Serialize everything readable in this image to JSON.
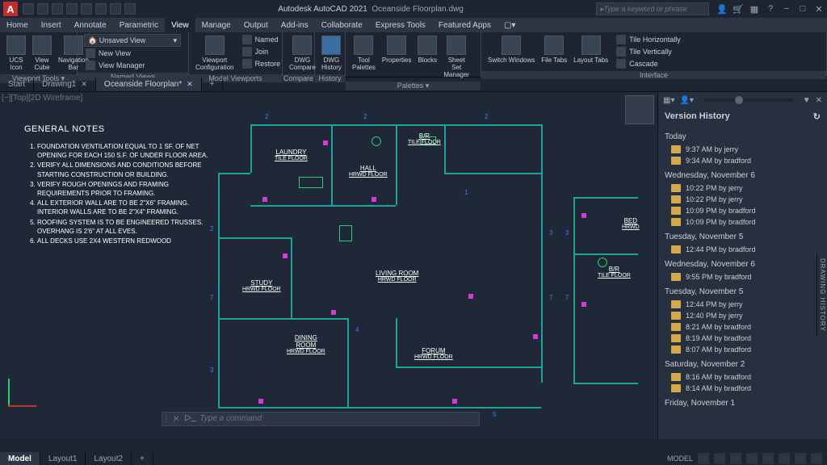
{
  "app": {
    "name": "Autodesk AutoCAD 2021",
    "document": "Oceanside Floorplan.dwg",
    "search_ph": "Type a keyword or phrase"
  },
  "menus": {
    "home": "Home",
    "insert": "Insert",
    "annotate": "Annotate",
    "parametric": "Parametric",
    "view": "View",
    "manage": "Manage",
    "output": "Output",
    "addins": "Add-ins",
    "collaborate": "Collaborate",
    "express": "Express Tools",
    "featured": "Featured Apps",
    "extra": "▢▾"
  },
  "ribbon": {
    "viewporttools": {
      "label": "Viewport Tools ▾",
      "ucs": "UCS\nIcon",
      "vcube": "View\nCube",
      "nav": "Navigation\nBar"
    },
    "namedviews": {
      "label": "Named Views",
      "combo": "Unsaved View",
      "newview": "New View",
      "viewmgr": "View Manager"
    },
    "modelvp": {
      "label": "Model Viewports",
      "vpconfig": "Viewport\nConfiguration",
      "named": "Named",
      "join": "Join",
      "restore": "Restore"
    },
    "compare": {
      "label": "Compare",
      "dwgcmp": "DWG\nCompare"
    },
    "history": {
      "label": "History",
      "dwghist": "DWG\nHistory"
    },
    "palettes": {
      "label": "Palettes ▾",
      "tool": "Tool\nPalettes",
      "prop": "Properties",
      "blocks": "Blocks",
      "sheet": "Sheet Set\nManager"
    },
    "interface": {
      "label": "Interface",
      "switch": "Switch\nWindows",
      "file": "File\nTabs",
      "layout": "Layout\nTabs",
      "tileh": "Tile Horizontally",
      "tilev": "Tile Vertically",
      "cascade": "Cascade"
    }
  },
  "tabs": {
    "start": "Start",
    "d1": "Drawing1",
    "d2": "Oceanside Floorplan*"
  },
  "viewport_label": "[−][Top][2D Wireframe]",
  "notes": {
    "title": "GENERAL NOTES",
    "items": [
      "FOUNDATION VENTILATION EQUAL TO 1 SF. OF NET OPENING FOR EACH 150 S.F. OF UNDER FLOOR AREA.",
      "VERIFY ALL DIMENSIONS AND CONDITIONS BEFORE STARTING CONSTRUCTION OR BUILDING.",
      "VERIFY ROUGH OPENINGS AND FRAMING REQUIREMENTS PRIOR TO FRAMING.",
      "ALL EXTERIOR WALL ARE TO BE 2\"X6\" FRAMING. INTERIOR WALLS ARE TO BE 2\"X4\" FRAMING.",
      "ROOFING SYSTEM IS TO BE ENGINEERED TRUSSES. OVERHANG IS 2'6\" AT ALL EVES.",
      "ALL DECKS USE 2X4 WESTERN REDWOOD"
    ]
  },
  "rooms": {
    "laundry": {
      "name": "LAUNDRY",
      "sub": "TILE FLOOR"
    },
    "hall": {
      "name": "HALL",
      "sub": "HRWD\nFLOOR"
    },
    "br": {
      "name": "B/R",
      "sub": "TILE\nFLOOR"
    },
    "study": {
      "name": "STUDY",
      "sub": "HRWD FLOOR"
    },
    "dining": {
      "name": "DINING\nROOM",
      "sub": "HRWD FLOOR"
    },
    "living": {
      "name": "LIVING ROOM",
      "sub": "HRWD FLOOR"
    },
    "forum": {
      "name": "FORUM",
      "sub": "HRWD FLOOR"
    },
    "bed": {
      "name": "BED",
      "sub": "HRWD"
    },
    "br2": {
      "name": "B/R",
      "sub": "TILE\nFLOOR"
    }
  },
  "cmd_ph": "Type a command",
  "layouttabs": {
    "model": "Model",
    "l1": "Layout1",
    "l2": "Layout2"
  },
  "status_label": "MODEL",
  "history": {
    "title": "Version History",
    "groups": [
      {
        "day": "Today",
        "entries": [
          "9:37 AM by jerry",
          "9:34 AM by bradford"
        ]
      },
      {
        "day": "Wednesday, November 6",
        "entries": [
          "10:22 PM by jerry",
          "10:22 PM by jerry",
          "10:09 PM by bradford",
          "10:09 PM by bradford"
        ]
      },
      {
        "day": "Tuesday, November 5",
        "entries": [
          "12:44 PM by bradford"
        ]
      },
      {
        "day": "Wednesday, November 6",
        "entries": [
          "9:55 PM by bradford"
        ]
      },
      {
        "day": "Tuesday, November 5",
        "entries": [
          "12:44 PM by jerry",
          "12:40 PM by jerry",
          "8:21 AM by bradford",
          "8:19 AM by bradford",
          "8:07 AM by bradford"
        ]
      },
      {
        "day": "Saturday, November 2",
        "entries": [
          "8:16 AM by bradford",
          "8:14 AM by bradford"
        ]
      },
      {
        "day": "Friday, November 1",
        "entries": []
      }
    ]
  },
  "sidetab": "DRAWING HISTORY"
}
